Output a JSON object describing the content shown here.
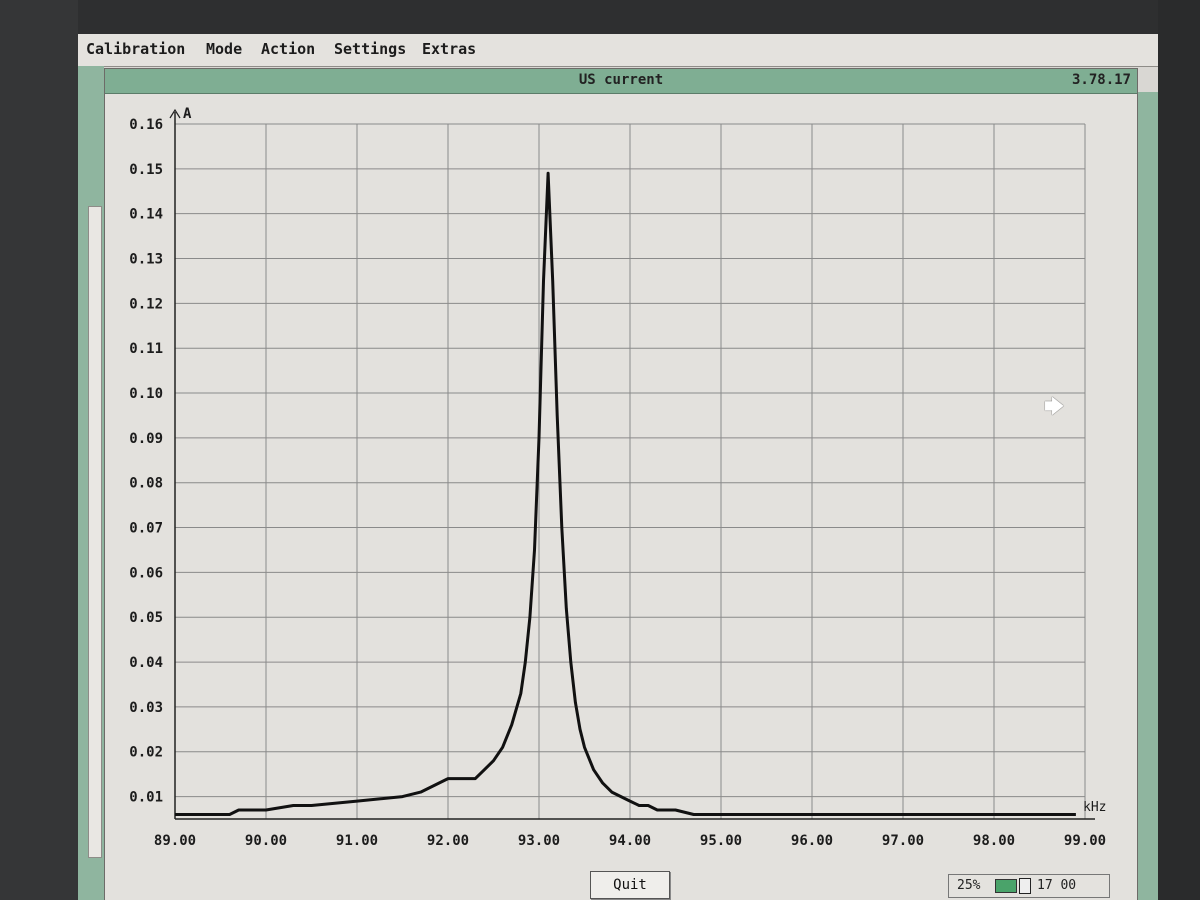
{
  "menu": [
    "Calibration",
    "Mode",
    "Action",
    "Settings",
    "Extras"
  ],
  "window": {
    "title": "US current",
    "version": "3.78.17"
  },
  "buttons": {
    "quit": "Quit"
  },
  "status": {
    "zoom": "25%",
    "time": "17 00"
  },
  "colors": {
    "screen": "#d9d7d3",
    "titlebar": "#7fae93",
    "trace": "#111111",
    "grid": "#8a8a8a"
  },
  "icons": {
    "cursor": "mouse-pointer-icon",
    "battery": "battery-icon",
    "box": "storage-icon"
  },
  "chart_data": {
    "type": "line",
    "title": "US current",
    "xlabel": "kHz",
    "ylabel": "A",
    "xlim": [
      89.0,
      99.0
    ],
    "ylim": [
      0.005,
      0.16
    ],
    "xticks": [
      "89.00",
      "90.00",
      "91.00",
      "92.00",
      "93.00",
      "94.00",
      "95.00",
      "96.00",
      "97.00",
      "98.00",
      "99.00"
    ],
    "yticks": [
      "0.16",
      "0.15",
      "0.14",
      "0.13",
      "0.12",
      "0.11",
      "0.10",
      "0.09",
      "0.08",
      "0.07",
      "0.06",
      "0.05",
      "0.04",
      "0.03",
      "0.02",
      "0.01"
    ],
    "grid": true,
    "series": [
      {
        "x": [
          89.0,
          89.6,
          89.7,
          90.0,
          90.3,
          90.4,
          90.5,
          91.0,
          91.5,
          91.7,
          91.8,
          91.9,
          92.0,
          92.1,
          92.3,
          92.4,
          92.5,
          92.6,
          92.7,
          92.8,
          92.85,
          92.9,
          92.95,
          93.0,
          93.05,
          93.1,
          93.15,
          93.2,
          93.25,
          93.3,
          93.35,
          93.4,
          93.45,
          93.5,
          93.6,
          93.7,
          93.8,
          93.9,
          94.0,
          94.1,
          94.2,
          94.3,
          94.5,
          94.7,
          94.9,
          95.1,
          95.3,
          95.6,
          96.0,
          96.5,
          97.0,
          97.5,
          98.0,
          98.5,
          98.9
        ],
        "y": [
          0.006,
          0.006,
          0.007,
          0.007,
          0.008,
          0.008,
          0.008,
          0.009,
          0.01,
          0.011,
          0.012,
          0.013,
          0.014,
          0.014,
          0.014,
          0.016,
          0.018,
          0.021,
          0.026,
          0.033,
          0.04,
          0.05,
          0.065,
          0.09,
          0.125,
          0.149,
          0.125,
          0.095,
          0.07,
          0.052,
          0.04,
          0.031,
          0.025,
          0.021,
          0.016,
          0.013,
          0.011,
          0.01,
          0.009,
          0.008,
          0.008,
          0.007,
          0.007,
          0.006,
          0.006,
          0.006,
          0.006,
          0.006,
          0.006,
          0.006,
          0.006,
          0.006,
          0.006,
          0.006,
          0.006
        ]
      }
    ]
  }
}
